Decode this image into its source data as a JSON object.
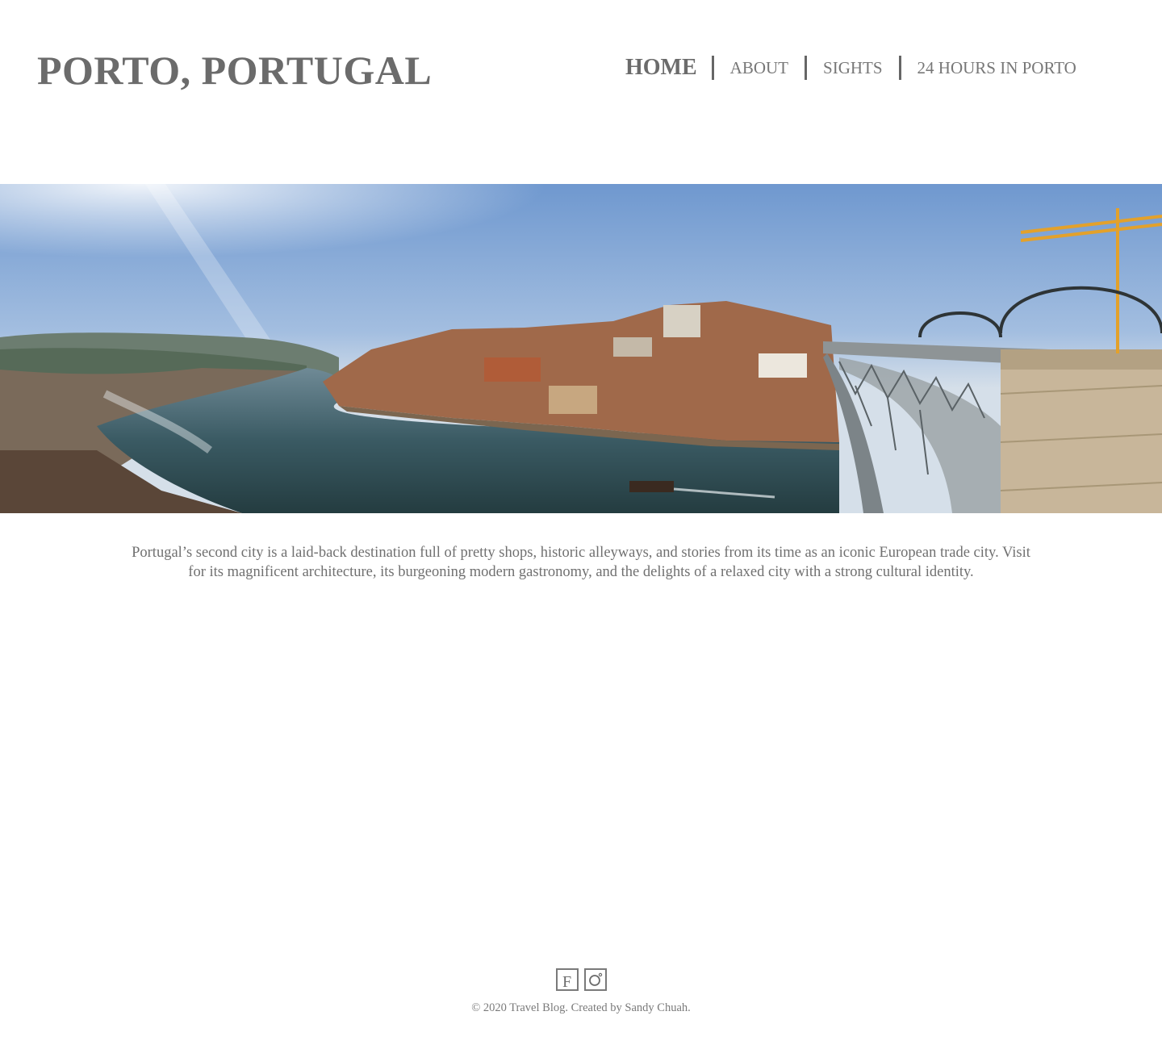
{
  "header": {
    "site_title": "PORTO, PORTUGAL",
    "nav": [
      {
        "label": "HOME",
        "active": true
      },
      {
        "label": "ABOUT",
        "active": false
      },
      {
        "label": "SIGHTS",
        "active": false
      },
      {
        "label": "24 HOURS IN PORTO",
        "active": false
      }
    ]
  },
  "hero": {
    "image_icon": "panorama-photo-icon"
  },
  "intro": {
    "text": "Portugal’s second city is a laid-back destination full of pretty shops, historic alleyways, and stories from its time as an iconic European trade city. Visit for its magnificent architecture, its burgeoning modern gastronomy, and the delights of a relaxed city with a strong cultural identity."
  },
  "footer": {
    "social": [
      {
        "icon": "facebook-icon",
        "glyph": "F"
      },
      {
        "icon": "instagram-icon"
      }
    ],
    "copyright": "© 2020 Travel Blog.  Created by Sandy Chuah."
  },
  "colors": {
    "text": "#6b6b6b",
    "background": "#ffffff",
    "sky": "#8fb0da",
    "river": "#2f4b52"
  }
}
